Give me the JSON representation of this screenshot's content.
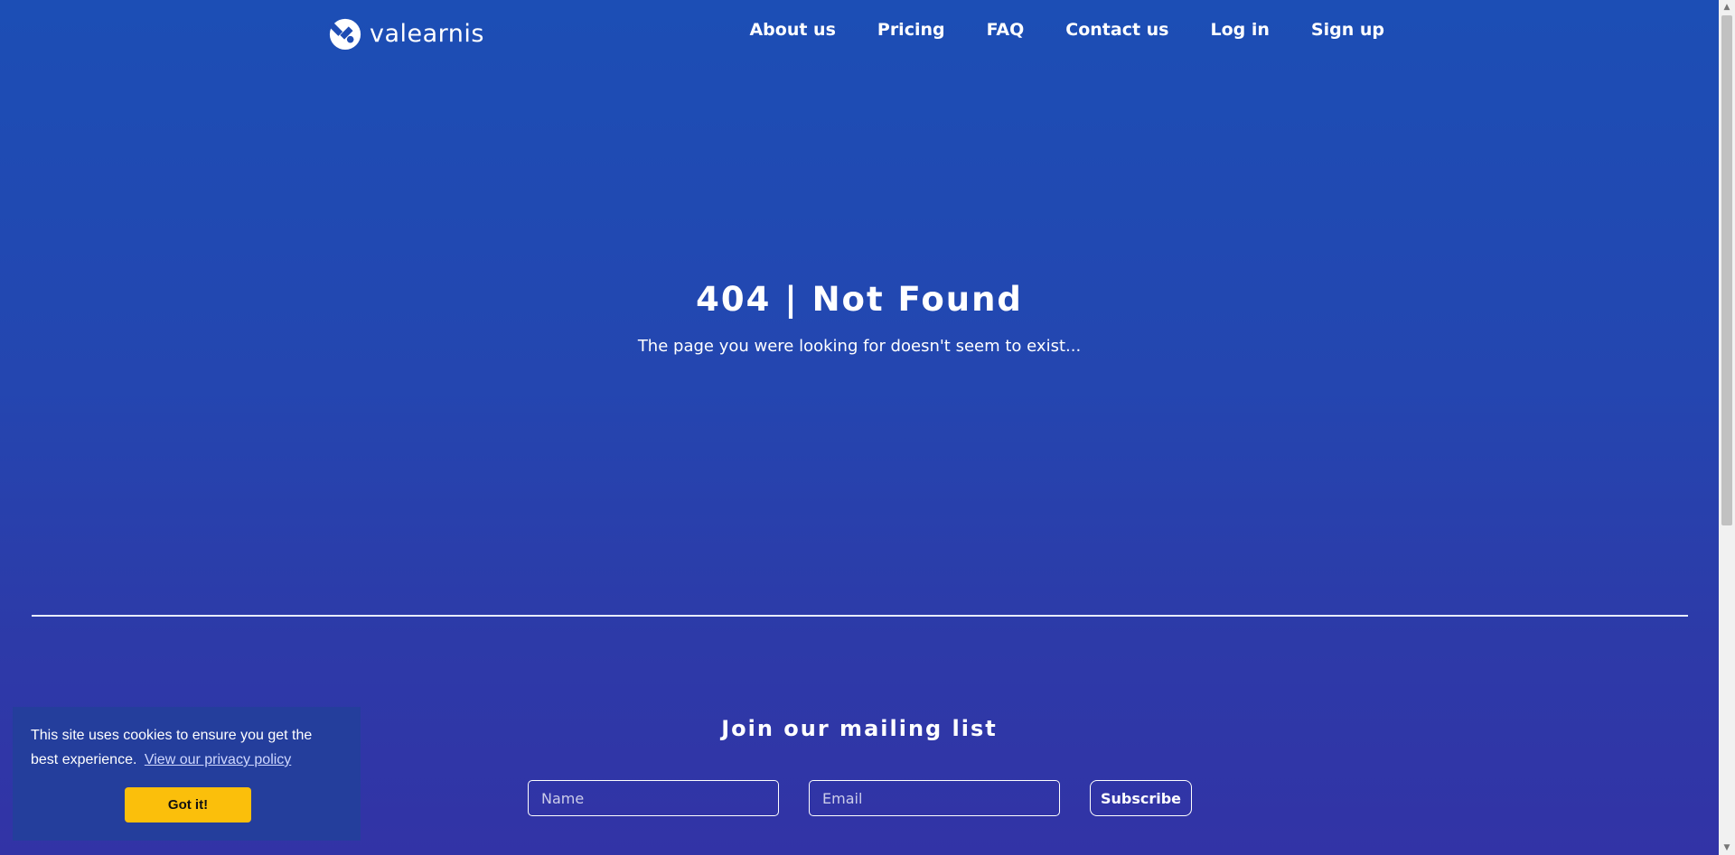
{
  "brand": {
    "name": "valearnis"
  },
  "nav": {
    "items": [
      {
        "label": "About us"
      },
      {
        "label": "Pricing"
      },
      {
        "label": "FAQ"
      },
      {
        "label": "Contact us"
      },
      {
        "label": "Log in"
      },
      {
        "label": "Sign up"
      }
    ]
  },
  "hero": {
    "title": "404 | Not Found",
    "message": "The page you were looking for doesn't seem to exist..."
  },
  "mailing": {
    "title": "Join our mailing list",
    "name_placeholder": "Name",
    "email_placeholder": "Email",
    "subscribe_label": "Subscribe"
  },
  "cookie": {
    "message": "This site uses cookies to ensure you get the best experience.",
    "link_label": "View our privacy policy",
    "button_label": "Got it!"
  },
  "colors": {
    "background_top": "#1c4eb5",
    "background_bottom": "#3233a6",
    "cookie_banner": "#243e9c",
    "cookie_button": "#fbbf0b"
  },
  "icons": {
    "logo": "valearnis-logo-icon",
    "scroll_up": "triangle-up-icon",
    "scroll_down": "triangle-down-icon"
  }
}
